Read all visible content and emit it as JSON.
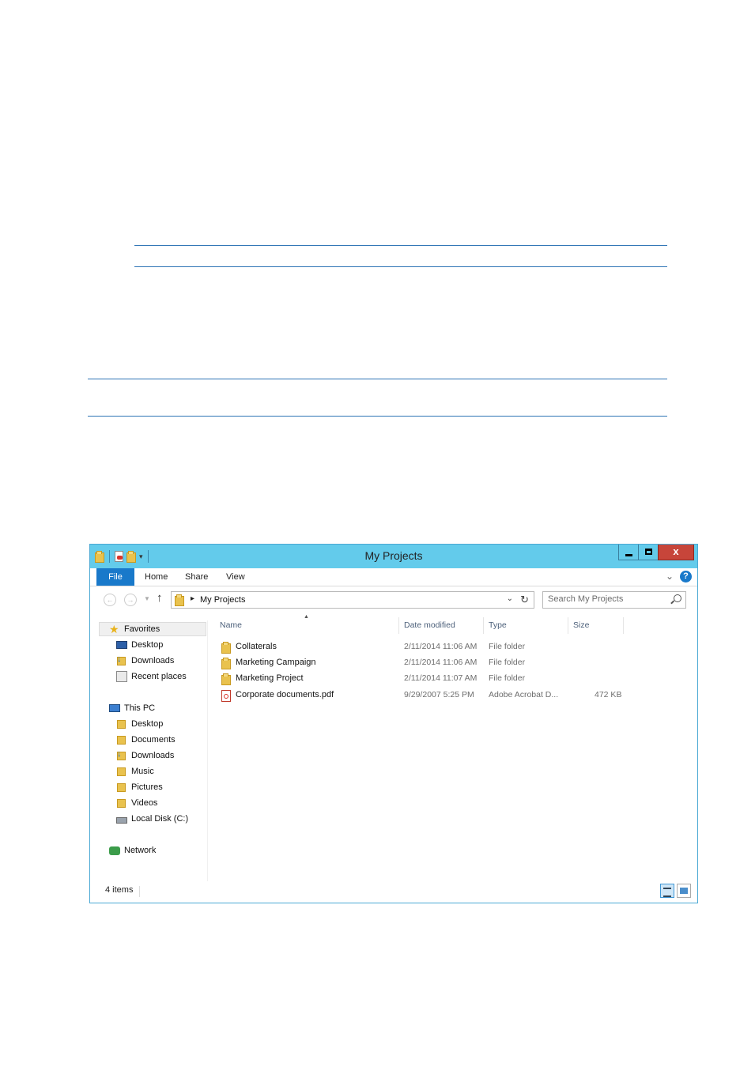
{
  "window": {
    "title": "My Projects",
    "close_label": "x"
  },
  "ribbon": {
    "tabs": [
      "File",
      "Home",
      "Share",
      "View"
    ]
  },
  "address": {
    "path": "My Projects"
  },
  "search": {
    "placeholder": "Search My Projects"
  },
  "navpane": {
    "favorites": "Favorites",
    "favorites_items": [
      "Desktop",
      "Downloads",
      "Recent places"
    ],
    "this_pc": "This PC",
    "this_pc_items": [
      "Desktop",
      "Documents",
      "Downloads",
      "Music",
      "Pictures",
      "Videos",
      "Local Disk (C:)"
    ],
    "network": "Network"
  },
  "columns": [
    "Name",
    "Date modified",
    "Type",
    "Size"
  ],
  "files": [
    {
      "name": "Collaterals",
      "date": "2/11/2014 11:06 AM",
      "type": "File folder",
      "size": "",
      "icon": "folder-icon"
    },
    {
      "name": "Marketing Campaign",
      "date": "2/11/2014 11:06 AM",
      "type": "File folder",
      "size": "",
      "icon": "folder-icon"
    },
    {
      "name": "Marketing Project",
      "date": "2/11/2014 11:07 AM",
      "type": "File folder",
      "size": "",
      "icon": "folder-icon"
    },
    {
      "name": "Corporate documents.pdf",
      "date": "9/29/2007 5:25 PM",
      "type": "Adobe Acrobat D...",
      "size": "472 KB",
      "icon": "pdf-icon"
    }
  ],
  "status": {
    "item_count": "4 items"
  },
  "colors": {
    "titlebar": "#63cbeb",
    "file_tab": "#1979ca",
    "close_button": "#c7453a",
    "rule": "#2e74b5"
  }
}
